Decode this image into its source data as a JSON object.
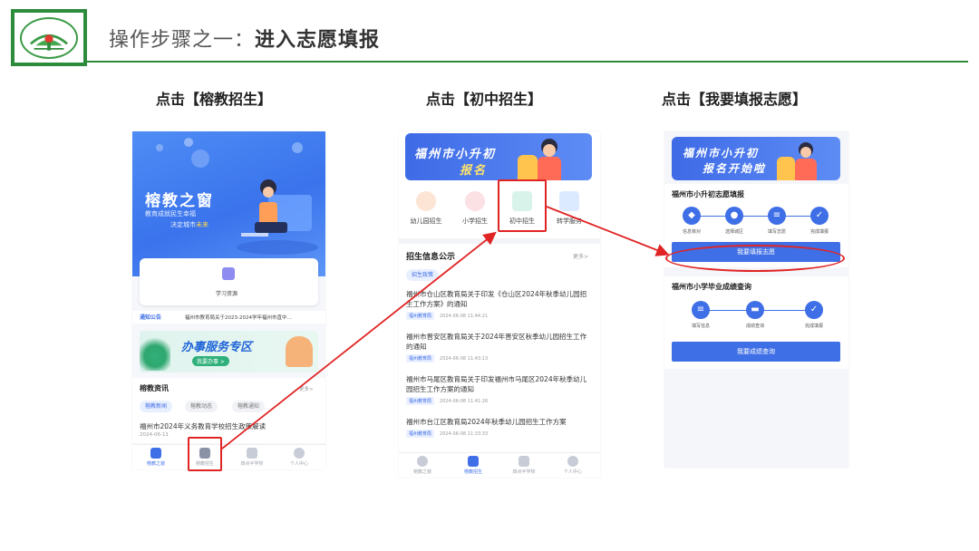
{
  "header": {
    "title_prefix": "操作步骤之一：",
    "title_main": "进入志愿填报"
  },
  "steps": [
    {
      "label": "点击【榕教招生】"
    },
    {
      "label": "点击【初中招生】"
    },
    {
      "label": "点击【我要填报志愿】"
    }
  ],
  "phone1": {
    "hero_title": "榕教之窗",
    "hero_line1": "教育成就民生幸福",
    "hero_line2a": "决定城市",
    "hero_line2b": "未来",
    "card_label": "学习资源",
    "notice_tag": "通知公告",
    "notice_text": "福州市教育局关于2023-2024学年福州市直中...",
    "banner_title": "办事服务专区",
    "banner_sub": "我要办事 >",
    "news_title": "榕教资讯",
    "news_more": "更多>",
    "news_tabs": [
      "榕教新闻",
      "榕教动态",
      "榕教通知"
    ],
    "news_item": "福州市2024年义务教育学校招生政策解读",
    "news_date": "2024-06-11",
    "tabbar": [
      "榕教之窗",
      "榕教招生",
      "四点半学校",
      "个人中心"
    ]
  },
  "phone2": {
    "banner_line1": "福州市小升初",
    "banner_line2": "报名",
    "categories": [
      "幼儿园招生",
      "小学招生",
      "初中招生",
      "转学服务"
    ],
    "section_title": "招生信息公示",
    "section_more": "更多>",
    "policy_tag": "招生政策",
    "news": [
      {
        "title": "福州市仓山区教育局关于印发《仓山区2024年秋季幼儿园招生工作方案》的通知",
        "source": "福州教育局",
        "date": "2024-06-08 11:44:21"
      },
      {
        "title": "福州市晋安区教育局关于2024年晋安区秋季幼儿园招生工作的通知",
        "source": "福州教育局",
        "date": "2024-06-08 11:43:13"
      },
      {
        "title": "福州市马尾区教育局关于印发福州市马尾区2024年秋季幼儿园招生工作方案的通知",
        "source": "福州教育局",
        "date": "2024-06-08 11:41:26"
      },
      {
        "title": "福州市台江区教育局2024年秋季幼儿园招生工作方案",
        "source": "福州教育局",
        "date": "2024-06-08 11:33:33"
      }
    ],
    "tabbar": [
      "榕教之窗",
      "榕教招生",
      "四点半学校",
      "个人中心"
    ]
  },
  "phone3": {
    "banner_line1": "福州市小升初",
    "banner_line2": "报名开始啦",
    "section1_title": "福州市小升初志愿填报",
    "section1_steps": [
      "信息核对",
      "选择城区",
      "填写志愿",
      "完成填报"
    ],
    "section1_button": "我要填报志愿",
    "section2_title": "福州市小学毕业成绩查询",
    "section2_steps": [
      "填写信息",
      "成绩查询",
      "完成填报"
    ],
    "section2_button": "我要成绩查询"
  },
  "colors": {
    "brand_green": "#2d8b3c",
    "app_blue": "#3f6fe6",
    "highlight_red": "#e02424"
  }
}
